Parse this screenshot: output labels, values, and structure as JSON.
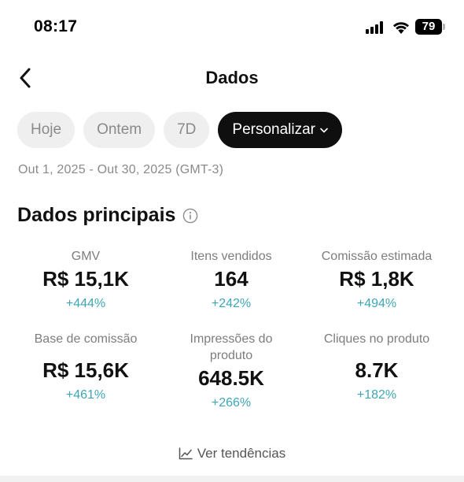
{
  "status": {
    "time": "08:17",
    "battery": "79"
  },
  "header": {
    "title": "Dados"
  },
  "chips": [
    {
      "label": "Hoje",
      "active": false
    },
    {
      "label": "Ontem",
      "active": false
    },
    {
      "label": "7D",
      "active": false
    },
    {
      "label": "Personalizar",
      "active": true
    }
  ],
  "date_range": "Out 1, 2025 - Out 30, 2025 (GMT-3)",
  "section": {
    "title": "Dados principais"
  },
  "metrics": [
    {
      "label": "GMV",
      "value": "R$ 15,1K",
      "change": "+444%"
    },
    {
      "label": "Itens vendidos",
      "value": "164",
      "change": "+242%"
    },
    {
      "label": "Comissão estimada",
      "value": "R$ 1,8K",
      "change": "+494%"
    },
    {
      "label": "Base de comissão",
      "value": "R$ 15,6K",
      "change": "+461%"
    },
    {
      "label": "Impressões do produto",
      "value": "648.5K",
      "change": "+266%"
    },
    {
      "label": "Cliques no produto",
      "value": "8.7K",
      "change": "+182%"
    }
  ],
  "trends": {
    "label": "Ver tendências"
  },
  "colors": {
    "accent_change": "#3fa5b3",
    "active_chip": "#0f0f0f",
    "chip_bg": "#efefef"
  }
}
